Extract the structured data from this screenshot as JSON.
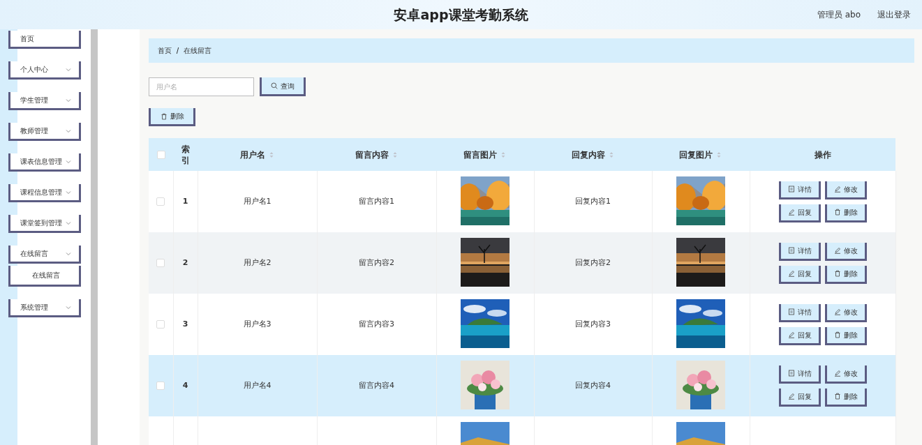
{
  "header": {
    "title": "安卓app课堂考勤系统",
    "user": "管理员 abo",
    "logout": "退出登录"
  },
  "sidebar": {
    "items": [
      {
        "label": "首页",
        "has_caret": false
      },
      {
        "label": "个人中心",
        "has_caret": true
      },
      {
        "label": "学生管理",
        "has_caret": true
      },
      {
        "label": "教师管理",
        "has_caret": true
      },
      {
        "label": "课表信息管理",
        "has_caret": true
      },
      {
        "label": "课程信息管理",
        "has_caret": true
      },
      {
        "label": "课堂签到管理",
        "has_caret": true
      },
      {
        "label": "在线留言",
        "has_caret": true,
        "children": [
          {
            "label": "在线留言"
          }
        ]
      },
      {
        "label": "系统管理",
        "has_caret": true
      }
    ]
  },
  "breadcrumb": [
    "首页",
    "在线留言"
  ],
  "search": {
    "placeholder": "用户名",
    "button": "查询"
  },
  "delete_button": "删除",
  "table": {
    "all_checked": false,
    "columns": [
      {
        "label": "索引",
        "sortable": false
      },
      {
        "label": "用户名",
        "sortable": true
      },
      {
        "label": "留言内容",
        "sortable": true
      },
      {
        "label": "留言图片",
        "sortable": true
      },
      {
        "label": "回复内容",
        "sortable": true
      },
      {
        "label": "回复图片",
        "sortable": true
      },
      {
        "label": "操作",
        "sortable": false
      }
    ],
    "rows": [
      {
        "index": "1",
        "username": "用户名1",
        "content": "留言内容1",
        "reply": "回复内容1",
        "checked": false,
        "hovered": false,
        "actions": [
          "详情",
          "修改",
          "回复",
          "删除"
        ]
      },
      {
        "index": "2",
        "username": "用户名2",
        "content": "留言内容2",
        "reply": "回复内容2",
        "checked": false,
        "hovered": false,
        "actions": [
          "详情",
          "修改",
          "回复",
          "删除"
        ]
      },
      {
        "index": "3",
        "username": "用户名3",
        "content": "留言内容3",
        "reply": "回复内容3",
        "checked": false,
        "hovered": false,
        "actions": [
          "详情",
          "修改",
          "回复",
          "删除"
        ]
      },
      {
        "index": "4",
        "username": "用户名4",
        "content": "留言内容4",
        "reply": "回复内容4",
        "checked": false,
        "hovered": true,
        "actions": [
          "详情",
          "修改",
          "回复",
          "删除"
        ]
      },
      {
        "hovered": false
      }
    ]
  }
}
